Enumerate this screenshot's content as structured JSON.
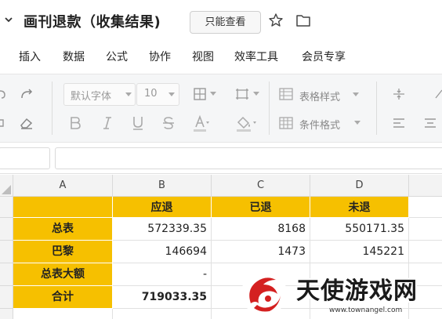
{
  "window": {
    "title": "画刊退款（收集结果)",
    "readonly_label": "只能查看"
  },
  "menu": {
    "items": [
      "插入",
      "数据",
      "公式",
      "协作",
      "视图",
      "效率工具",
      "会员专享"
    ]
  },
  "toolbar": {
    "font_family": "默认字体",
    "font_size": "10",
    "table_style_label": "表格样式",
    "conditional_format_label": "条件格式"
  },
  "sheet": {
    "columns": [
      "A",
      "B",
      "C",
      "D"
    ],
    "headers": [
      "",
      "应退",
      "已退",
      "未退"
    ],
    "rows": [
      {
        "label": "总表",
        "b": "572339.35",
        "c": "8168",
        "d": "550171.35"
      },
      {
        "label": "巴黎",
        "b": "146694",
        "c": "1473",
        "d": "145221"
      },
      {
        "label": "总表大额",
        "b": "-",
        "c": "",
        "d": ""
      },
      {
        "label": "合计",
        "b": "719033.35",
        "c": "",
        "d": ""
      }
    ]
  },
  "watermark": {
    "text": "天使游戏网",
    "url": "www.townangel.com"
  },
  "colors": {
    "header_fill": "#f6c000",
    "toolbar_bg": "#f5f6f7"
  }
}
